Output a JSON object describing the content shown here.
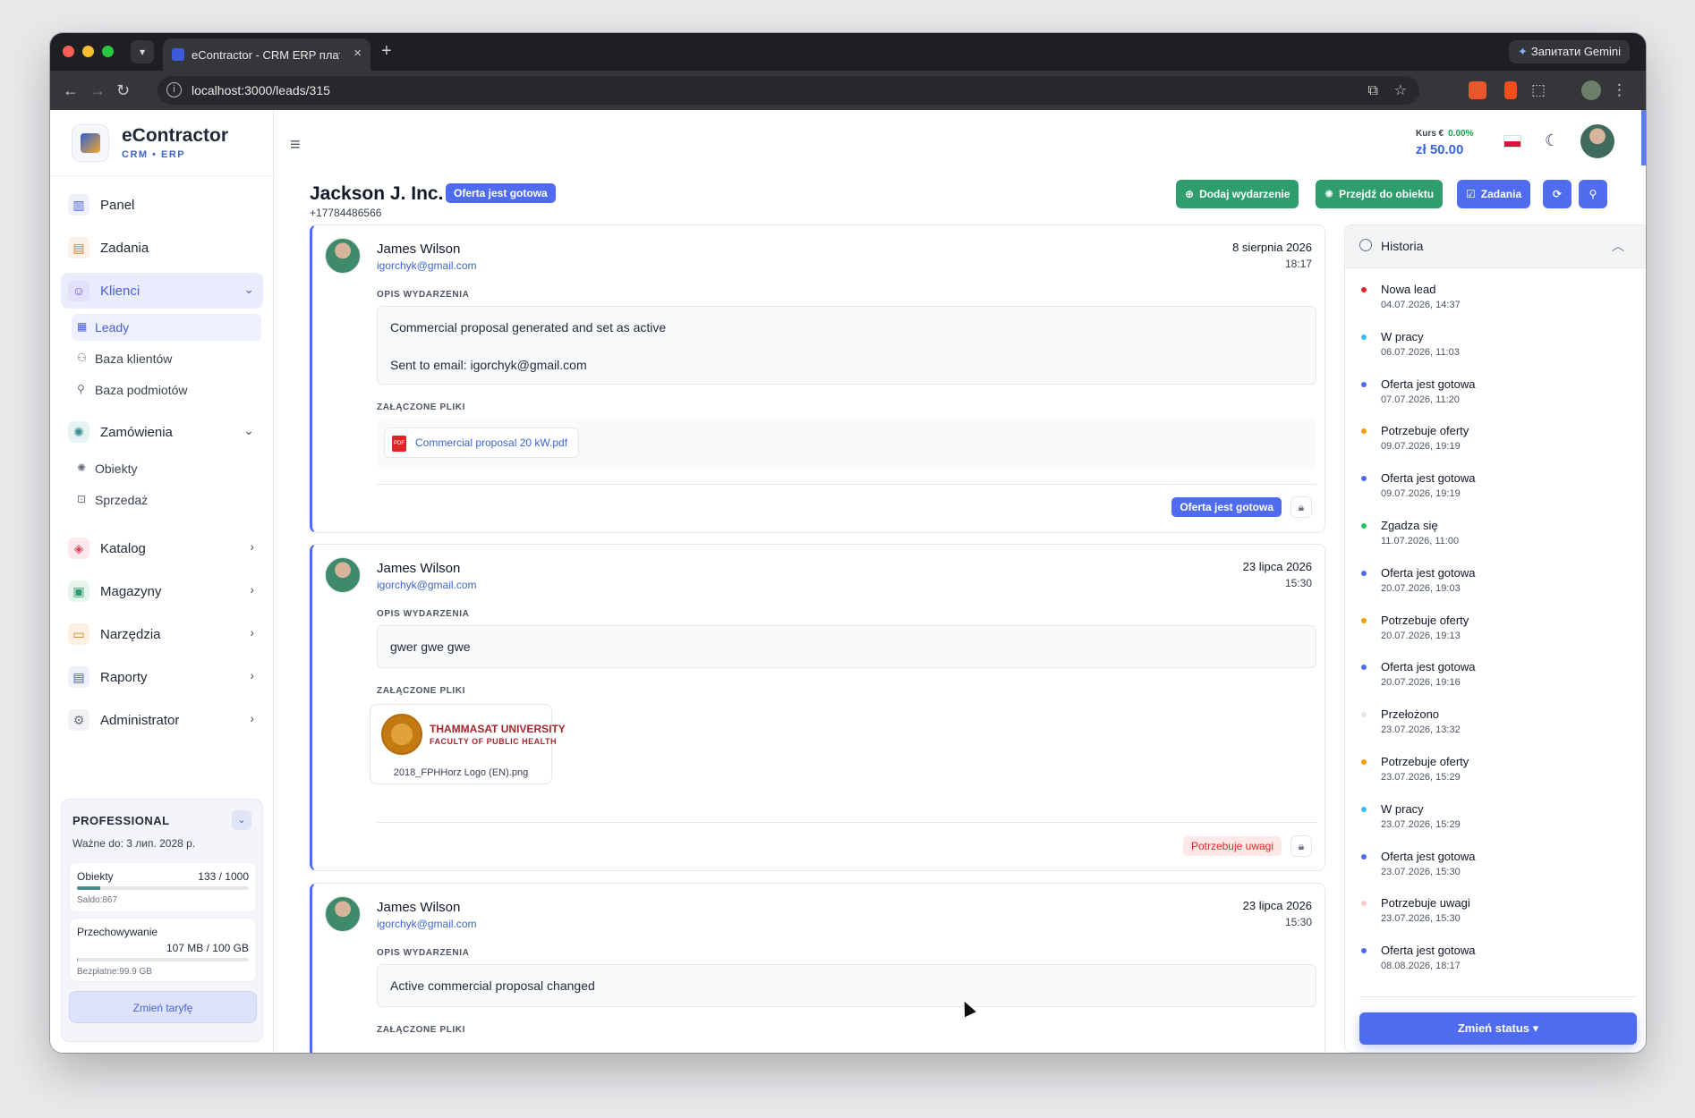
{
  "browser": {
    "tab_title": "eContractor - CRM ERP плат",
    "url": "localhost:3000/leads/315",
    "gemini_label": "Запитати Gemini",
    "icons": [
      "back-icon",
      "forward-icon",
      "reload-icon",
      "info-icon",
      "install-icon",
      "star-icon",
      "extensions-icon",
      "more-icon"
    ]
  },
  "brand": {
    "name": "eContractor",
    "sub": "CRM • ERP"
  },
  "sidebar": {
    "items": [
      {
        "label": "Panel",
        "icon": "chart-icon"
      },
      {
        "label": "Zadania",
        "icon": "clipboard-icon"
      },
      {
        "label": "Klienci",
        "icon": "users-icon"
      },
      {
        "label": "Zamówienia",
        "icon": "orders-icon"
      },
      {
        "label": "Katalog",
        "icon": "box-icon"
      },
      {
        "label": "Magazyny",
        "icon": "warehouse-icon"
      },
      {
        "label": "Narzędzia",
        "icon": "toolbox-icon"
      },
      {
        "label": "Raporty",
        "icon": "report-icon"
      },
      {
        "label": "Administrator",
        "icon": "gear-icon"
      }
    ],
    "klienci_sub": [
      "Leady",
      "Baza klientów",
      "Baza podmiotów"
    ],
    "zamowienia_sub": [
      "Obiekty",
      "Sprzedaż"
    ]
  },
  "plan": {
    "title": "PROFESSIONAL",
    "valid": "Ważne do: 3 лип. 2028 р.",
    "objects_label": "Obiekty",
    "objects_value": "133 / 1000",
    "objects_fraction": 0.133,
    "saldo": "Saldo:867",
    "storage_label": "Przechowywanie",
    "storage_value": "107 MB / 100 GB",
    "storage_fraction": 0.001,
    "free": "Bezpłatne:99.9 GB",
    "button": "Zmień taryfę"
  },
  "header": {
    "kurs_label": "Kurs €",
    "kurs_pct": "0.00%",
    "kurs_value": "zł 50.00"
  },
  "lead": {
    "title": "Jackson J. Inc.",
    "status": "Oferta jest gotowa",
    "phone": "+17784486566",
    "buttons": {
      "add_event": "Dodaj wydarzenie",
      "go_object": "Przejdź do obiektu",
      "tasks": "Zadania"
    }
  },
  "labels": {
    "desc": "OPIS WYDARZENIA",
    "files": "ZAŁĄCZONE PLIKI"
  },
  "events": [
    {
      "name": "James Wilson",
      "email": "igorchyk@gmail.com",
      "date": "8 sierpnia 2026",
      "time": "18:17",
      "desc1": "Commercial proposal generated and set as active",
      "desc2": "Sent to email: igorchyk@gmail.com",
      "file": "Commercial proposal 20 kW.pdf",
      "pdf_tag": "PDF",
      "status": "Oferta jest gotowa"
    },
    {
      "name": "James Wilson",
      "email": "igorchyk@gmail.com",
      "date": "23 lipca 2026",
      "time": "15:30",
      "desc1": "gwer gwe gwe",
      "thumb_line1": "THAMMASAT UNIVERSITY",
      "thumb_line2": "FACULTY OF PUBLIC HEALTH",
      "file": "2018_FPHHorz Logo (EN).png",
      "status": "Potrzebuje uwagi"
    },
    {
      "name": "James Wilson",
      "email": "igorchyk@gmail.com",
      "date": "23 lipca 2026",
      "time": "15:30",
      "desc1": "Active commercial proposal changed"
    }
  ],
  "history": {
    "title": "Historia",
    "button": "Zmień status",
    "items": [
      {
        "status": "Nowa lead",
        "date": "04.07.2026, 14:37",
        "color": "#dc2626"
      },
      {
        "status": "W pracy",
        "date": "06.07.2026, 11:03",
        "color": "#38bdf8"
      },
      {
        "status": "Oferta jest gotowa",
        "date": "07.07.2026, 11:20",
        "color": "#4f6cf0"
      },
      {
        "status": "Potrzebuje oferty",
        "date": "09.07.2026, 19:19",
        "color": "#f59e0b"
      },
      {
        "status": "Oferta jest gotowa",
        "date": "09.07.2026, 19:19",
        "color": "#4f6cf0"
      },
      {
        "status": "Zgadza się",
        "date": "11.07.2026, 11:00",
        "color": "#22c55e"
      },
      {
        "status": "Oferta jest gotowa",
        "date": "20.07.2026, 19:03",
        "color": "#4f6cf0"
      },
      {
        "status": "Potrzebuje oferty",
        "date": "20.07.2026, 19:13",
        "color": "#f59e0b"
      },
      {
        "status": "Oferta jest gotowa",
        "date": "20.07.2026, 19:16",
        "color": "#4f6cf0"
      },
      {
        "status": "Przełożono",
        "date": "23.07.2026, 13:32",
        "color": "#e5e7eb"
      },
      {
        "status": "Potrzebuje oferty",
        "date": "23.07.2026, 15:29",
        "color": "#f59e0b"
      },
      {
        "status": "W pracy",
        "date": "23.07.2026, 15:29",
        "color": "#38bdf8"
      },
      {
        "status": "Oferta jest gotowa",
        "date": "23.07.2026, 15:30",
        "color": "#4f6cf0"
      },
      {
        "status": "Potrzebuje uwagi",
        "date": "23.07.2026, 15:30",
        "color": "#fecaca"
      },
      {
        "status": "Oferta jest gotowa",
        "date": "08.08.2026, 18:17",
        "color": "#4f6cf0"
      }
    ]
  },
  "colors": {
    "accent": "#4f6cf0",
    "green": "#2f9e6e",
    "danger": "#dc2626"
  }
}
